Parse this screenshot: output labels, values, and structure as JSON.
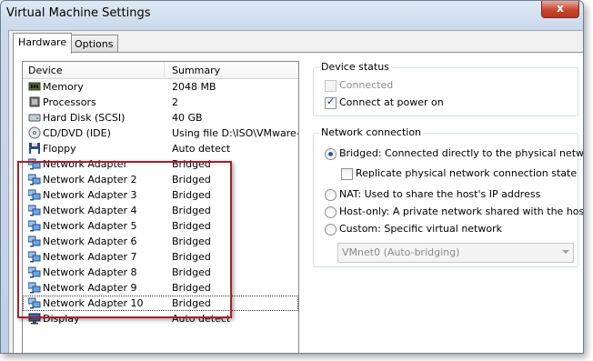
{
  "window": {
    "title": "Virtual Machine Settings",
    "close_label": "x"
  },
  "tabs": [
    {
      "label": "Hardware"
    },
    {
      "label": "Options"
    }
  ],
  "device_list": {
    "col_device": "Device",
    "col_summary": "Summary",
    "rows": [
      {
        "name": "Memory",
        "summary": "2048 MB",
        "icon": "memory-icon"
      },
      {
        "name": "Processors",
        "summary": "2",
        "icon": "processor-icon"
      },
      {
        "name": "Hard Disk (SCSI)",
        "summary": "40 GB",
        "icon": "hard-disk-icon"
      },
      {
        "name": "CD/DVD (IDE)",
        "summary": "Using file D:\\ISO\\VMware-VM",
        "icon": "cd-dvd-icon"
      },
      {
        "name": "Floppy",
        "summary": "Auto detect",
        "icon": "floppy-icon"
      },
      {
        "name": "Network Adapter",
        "summary": "Bridged",
        "icon": "network-adapter-icon"
      },
      {
        "name": "Network Adapter 2",
        "summary": "Bridged",
        "icon": "network-adapter-icon"
      },
      {
        "name": "Network Adapter 3",
        "summary": "Bridged",
        "icon": "network-adapter-icon"
      },
      {
        "name": "Network Adapter 4",
        "summary": "Bridged",
        "icon": "network-adapter-icon"
      },
      {
        "name": "Network Adapter 5",
        "summary": "Bridged",
        "icon": "network-adapter-icon"
      },
      {
        "name": "Network Adapter 6",
        "summary": "Bridged",
        "icon": "network-adapter-icon"
      },
      {
        "name": "Network Adapter 7",
        "summary": "Bridged",
        "icon": "network-adapter-icon"
      },
      {
        "name": "Network Adapter 8",
        "summary": "Bridged",
        "icon": "network-adapter-icon"
      },
      {
        "name": "Network Adapter 9",
        "summary": "Bridged",
        "icon": "network-adapter-icon"
      },
      {
        "name": "Network Adapter 10",
        "summary": "Bridged",
        "icon": "network-adapter-icon"
      },
      {
        "name": "Display",
        "summary": "Auto detect",
        "icon": "display-icon"
      }
    ]
  },
  "device_status": {
    "legend": "Device status",
    "connected_label": "Connected",
    "connected_checked": false,
    "connect_at_power_on_label": "Connect at power on",
    "connect_at_power_on_checked": true
  },
  "network_connection": {
    "legend": "Network connection",
    "bridged_label": "Bridged: Connected directly to the physical network",
    "replicate_label": "Replicate physical network connection state",
    "replicate_checked": false,
    "nat_label": "NAT: Used to share the host's IP address",
    "hostonly_label": "Host-only: A private network shared with the host",
    "custom_label": "Custom: Specific virtual network",
    "selected": "bridged",
    "custom_combo_value": "VMnet0 (Auto-bridging)"
  },
  "colors": {
    "highlight_box": "#a8202a",
    "title_bg": "#cbd9ea",
    "close_button": "#c9462e"
  }
}
